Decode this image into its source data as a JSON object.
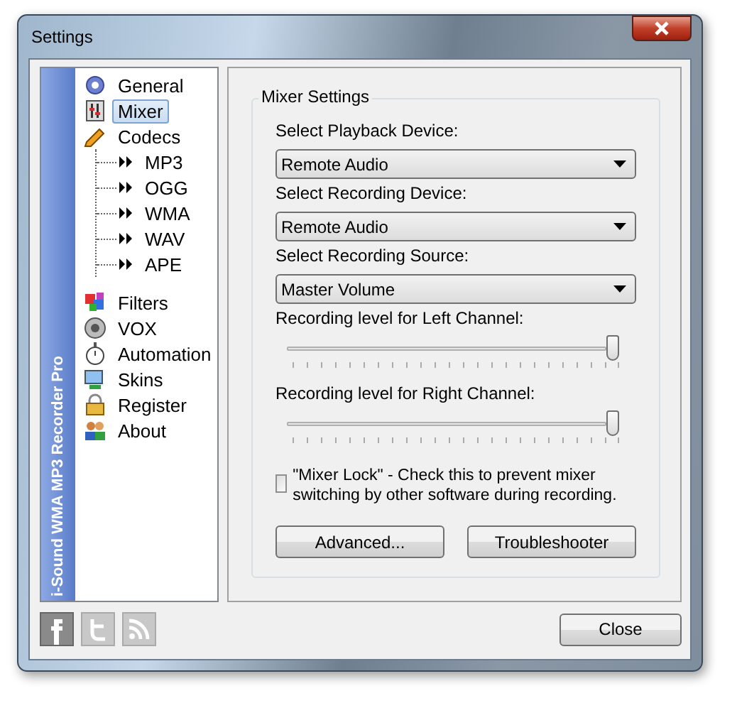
{
  "window": {
    "title": "Settings"
  },
  "sidebar": {
    "banner": "i-Sound WMA MP3 Recorder Pro",
    "items": [
      {
        "label": "General",
        "selected": false
      },
      {
        "label": "Mixer",
        "selected": true
      },
      {
        "label": "Codecs",
        "selected": false,
        "children": [
          {
            "label": "MP3",
            "selected": false
          },
          {
            "label": "OGG",
            "selected": false
          },
          {
            "label": "WMA",
            "selected": false
          },
          {
            "label": "WAV",
            "selected": false
          },
          {
            "label": "APE",
            "selected": false
          }
        ]
      },
      {
        "label": "Filters",
        "selected": false
      },
      {
        "label": "VOX",
        "selected": false
      },
      {
        "label": "Automation",
        "selected": false
      },
      {
        "label": "Skins",
        "selected": false
      },
      {
        "label": "Register",
        "selected": false
      },
      {
        "label": "About",
        "selected": false
      }
    ]
  },
  "mixer": {
    "title": "Mixer Settings",
    "dropdowns": [
      {
        "label": "Select Playback Device:",
        "value": "Remote Audio"
      },
      {
        "label": "Select Recording Device:",
        "value": "Remote Audio"
      },
      {
        "label": "Select Recording Source:",
        "value": "Master Volume"
      }
    ],
    "sliders": [
      {
        "label": "Recording level for Left Channel:",
        "level": 1
      },
      {
        "label": "Recording level for Right Channel:",
        "level": 1
      }
    ],
    "mixer_lock": {
      "label": "\"Mixer Lock\" - Check this to prevent mixer switching by other software during recording.",
      "checked": false
    },
    "buttons": [
      "Advanced...",
      "Troubleshooter"
    ]
  },
  "footer": {
    "button": "Close"
  }
}
